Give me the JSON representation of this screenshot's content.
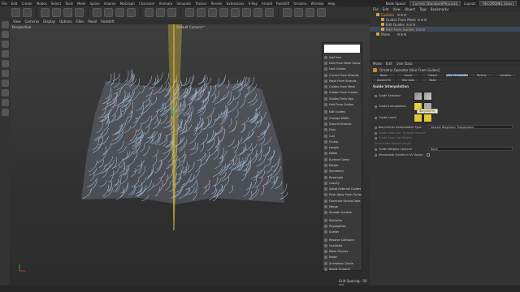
{
  "menubar": {
    "items": [
      "File",
      "Edit",
      "Create",
      "Modes",
      "Select",
      "Tools",
      "Mesh",
      "Spline",
      "Volume",
      "MoGraph",
      "Character",
      "Animate",
      "Simulate",
      "Tracker",
      "Render",
      "Extensions",
      "X-Rep",
      "Arnold",
      "Redshift",
      "Ornatrix",
      "Window",
      "Help"
    ],
    "node_space_label": "Node Space:",
    "node_space_value": "Current (Standard/Physical)",
    "layout_label": "Layout:",
    "layout_value": "RECORDING (User)"
  },
  "viewport": {
    "menu": [
      "View",
      "Cameras",
      "Display",
      "Options",
      "Filter",
      "Panel",
      "Redshift"
    ],
    "label": "Perspective",
    "camera": "Default Camera™",
    "grid_spacing": "Grid Spacing : 50 cm"
  },
  "popup_menu": {
    "items": [
      [
        "Add Hair",
        "Hair From Mesh Strips",
        "Hair Guides",
        "Curves From Strands",
        "Mesh From Strands",
        "Guides From Mesh",
        "Guides From Curves",
        "Guides From Hair",
        "Hair From Guides"
      ],
      [
        "Edit Guides",
        "Change Width",
        "Ground Strands",
        "Frizz",
        "Curl",
        "Clump",
        "Length",
        "Detail",
        "Surface Comb",
        "Rotate",
        "Symmetry",
        "Resample",
        "Gravity",
        "Adopt External Guides",
        "Push Away From Surface",
        "Generate Strand Data",
        "Merge",
        "Smooth Surface"
      ],
      [
        "Multiplier",
        "Propagation",
        "Scatter"
      ],
      [
        "Resolve Collisions",
        "Oscillator",
        "Moov Physics",
        "Noise",
        "Animation Cache",
        "About Ornatrix"
      ]
    ]
  },
  "object_manager": {
    "menu": [
      "File",
      "Edit",
      "View",
      "Object",
      "Tags",
      "Bookmarks"
    ],
    "objects": [
      {
        "name": "Cushion",
        "indent": 0,
        "highlight": true
      },
      {
        "name": "Guides From Mesh",
        "indent": 1,
        "highlight": false
      },
      {
        "name": "Edit Guides",
        "indent": 1,
        "highlight": false
      },
      {
        "name": "Hair From Guides",
        "indent": 1,
        "highlight": true
      },
      {
        "name": "Plane",
        "indent": 0,
        "highlight": false
      }
    ]
  },
  "attribute_manager": {
    "menu": [
      "Mode",
      "Edit",
      "User Data"
    ],
    "title": "Ornatrix Operator [Hair From Guides]",
    "tabs": [
      "Basic",
      "Coord.",
      "Object",
      "Guide Interpolation",
      "Parting",
      "Location",
      "Applied To",
      "Hair Data",
      "Bake"
    ],
    "active_tab": "Guide Interpolation",
    "section": "Guide Interpolation",
    "props": {
      "guide_selection": "Guide Selection",
      "guide_interpolation": "Guide Interpolation",
      "guide_count": "Guide Count",
      "barycentric": "Barycentric Interpolation Type",
      "barycentric_value": "Nearest Neighbour Triangulation",
      "guide_area_calc": "Guide Area Calc Through Second",
      "guide_area_calc_radius": "Guide Area Calc Radius",
      "interpolate_root": "Interpolate Strand Length",
      "guide_weights": "Guide Weights Channel",
      "guide_weights_value": "None",
      "interpolate_uv": "Interpolate Guides in UV Space"
    },
    "tooltip": "Barycentric"
  },
  "colors": {
    "accent": "#4f6584",
    "hair": "#a9c7e6",
    "axis_yellow": "#e6c73a"
  }
}
